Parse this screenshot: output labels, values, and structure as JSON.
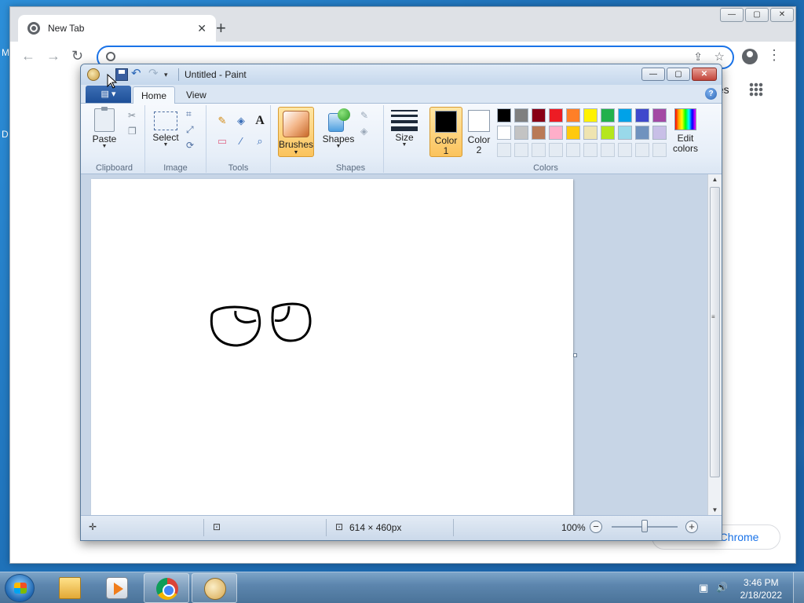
{
  "desktop": {
    "frag_m": "M",
    "frag_d": "D"
  },
  "chrome": {
    "tab_title": "New Tab",
    "tab_close": "✕",
    "new_tab": "+",
    "back": "←",
    "forward": "→",
    "reload": "↻",
    "share": "⇪",
    "star": "☆",
    "menu": "⋮",
    "apps_label": "ges",
    "customize_label": "e Chrome",
    "win_min": "—",
    "win_max": "▢",
    "win_close": "✕"
  },
  "paint": {
    "title": "Untitled - Paint",
    "undo": "↶",
    "redo": "↷",
    "qa_dropdown": "▾",
    "win_min": "—",
    "win_max": "▢",
    "win_close": "✕",
    "file_menu": "▤ ▾",
    "tabs": {
      "home": "Home",
      "view": "View"
    },
    "help": "?",
    "groups": {
      "clipboard": "Clipboard",
      "image": "Image",
      "tools": "Tools",
      "shapes": "Shapes",
      "colors": "Colors"
    },
    "buttons": {
      "paste": "Paste",
      "select": "Select",
      "brushes": "Brushes",
      "shapes": "Shapes",
      "size": "Size",
      "color1_line1": "Color",
      "color1_line2": "1",
      "color2_line1": "Color",
      "color2_line2": "2",
      "edit_colors_line1": "Edit",
      "edit_colors_line2": "colors"
    },
    "tool_glyphs": {
      "cut": "✂",
      "copy": "❐",
      "crop": "⌗",
      "resize": "⤢",
      "rotate": "⟳",
      "pencil": "✎",
      "fill": "◈",
      "text": "A",
      "eraser": "▭",
      "picker": "⁄",
      "magnifier": "⌕",
      "outline": "✎",
      "shape_fill": "◈"
    },
    "color1": "#000000",
    "color2": "#ffffff",
    "palette": [
      "#000000",
      "#7f7f7f",
      "#880015",
      "#ed1c24",
      "#ff7f27",
      "#fff200",
      "#22b14c",
      "#00a2e8",
      "#3f48cc",
      "#a349a4",
      "#ffffff",
      "#c3c3c3",
      "#b97a57",
      "#ffaec9",
      "#ffc90e",
      "#efe4b0",
      "#b5e61d",
      "#99d9ea",
      "#7092be",
      "#c8bfe7",
      "",
      "",
      "",
      "",
      "",
      "",
      "",
      "",
      "",
      ""
    ],
    "status": {
      "canvas_size": "614 × 460px",
      "zoom": "100%",
      "zoom_out": "−",
      "zoom_in": "+"
    }
  },
  "taskbar": {
    "time": "3:46 PM",
    "date": "2/18/2022",
    "network": "▣",
    "volume": "🔊"
  }
}
